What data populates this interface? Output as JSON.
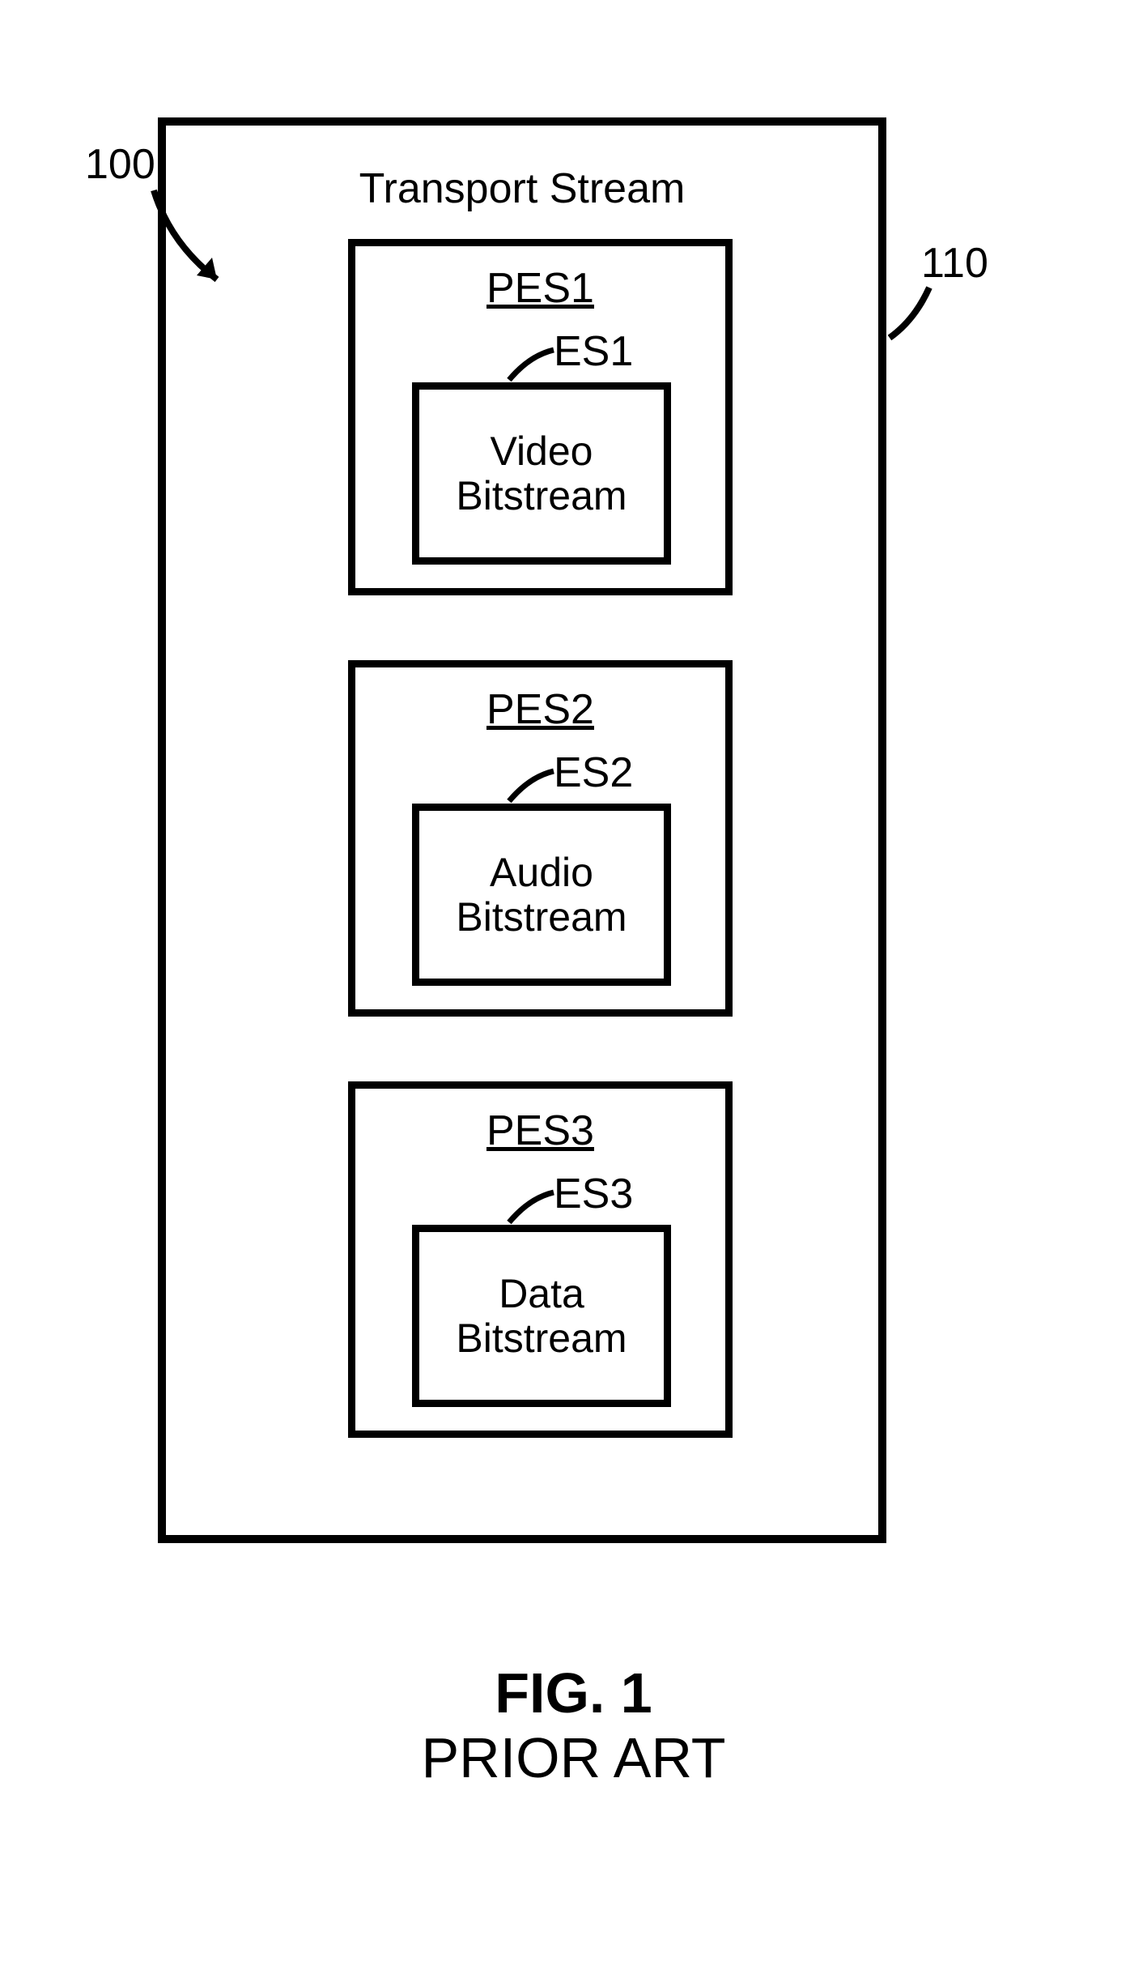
{
  "title": "Transport Stream",
  "callouts": {
    "left": "100",
    "right": "110"
  },
  "pes": [
    {
      "label": "PES1",
      "es_label": "ES1",
      "content_line1": "Video",
      "content_line2": "Bitstream"
    },
    {
      "label": "PES2",
      "es_label": "ES2",
      "content_line1": "Audio",
      "content_line2": "Bitstream"
    },
    {
      "label": "PES3",
      "es_label": "ES3",
      "content_line1": "Data",
      "content_line2": "Bitstream"
    }
  ],
  "figure": {
    "title": "FIG. 1",
    "subtitle": "PRIOR ART"
  }
}
